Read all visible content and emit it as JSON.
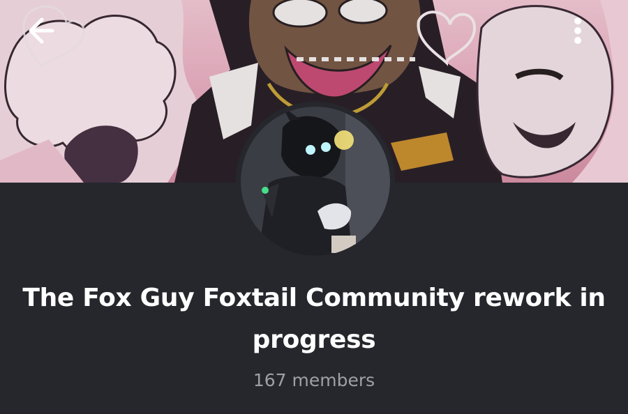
{
  "header": {
    "back_icon": "arrow-left-icon",
    "menu_icon": "more-vertical-icon",
    "banner_description_colors": {
      "pink": "#f3c9d6",
      "dark": "#2a2330"
    }
  },
  "community": {
    "name": "The Fox Guy Foxtail Community rework in progress",
    "member_count": "167 members"
  },
  "colors": {
    "background": "#26272d",
    "title": "#ffffff",
    "subtitle": "#9fa0a6"
  }
}
